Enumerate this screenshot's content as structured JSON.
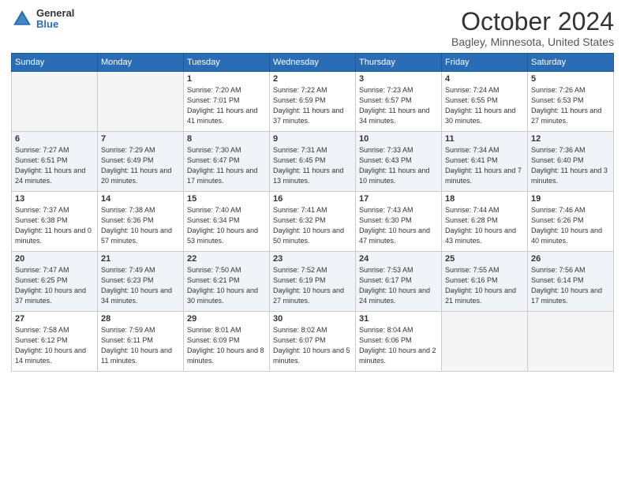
{
  "header": {
    "logo": {
      "general": "General",
      "blue": "Blue"
    },
    "title": "October 2024",
    "subtitle": "Bagley, Minnesota, United States"
  },
  "calendar": {
    "days_of_week": [
      "Sunday",
      "Monday",
      "Tuesday",
      "Wednesday",
      "Thursday",
      "Friday",
      "Saturday"
    ],
    "weeks": [
      [
        {
          "day": "",
          "empty": true
        },
        {
          "day": "",
          "empty": true
        },
        {
          "day": "1",
          "sunrise": "7:20 AM",
          "sunset": "7:01 PM",
          "daylight": "11 hours and 41 minutes."
        },
        {
          "day": "2",
          "sunrise": "7:22 AM",
          "sunset": "6:59 PM",
          "daylight": "11 hours and 37 minutes."
        },
        {
          "day": "3",
          "sunrise": "7:23 AM",
          "sunset": "6:57 PM",
          "daylight": "11 hours and 34 minutes."
        },
        {
          "day": "4",
          "sunrise": "7:24 AM",
          "sunset": "6:55 PM",
          "daylight": "11 hours and 30 minutes."
        },
        {
          "day": "5",
          "sunrise": "7:26 AM",
          "sunset": "6:53 PM",
          "daylight": "11 hours and 27 minutes."
        }
      ],
      [
        {
          "day": "6",
          "sunrise": "7:27 AM",
          "sunset": "6:51 PM",
          "daylight": "11 hours and 24 minutes."
        },
        {
          "day": "7",
          "sunrise": "7:29 AM",
          "sunset": "6:49 PM",
          "daylight": "11 hours and 20 minutes."
        },
        {
          "day": "8",
          "sunrise": "7:30 AM",
          "sunset": "6:47 PM",
          "daylight": "11 hours and 17 minutes."
        },
        {
          "day": "9",
          "sunrise": "7:31 AM",
          "sunset": "6:45 PM",
          "daylight": "11 hours and 13 minutes."
        },
        {
          "day": "10",
          "sunrise": "7:33 AM",
          "sunset": "6:43 PM",
          "daylight": "11 hours and 10 minutes."
        },
        {
          "day": "11",
          "sunrise": "7:34 AM",
          "sunset": "6:41 PM",
          "daylight": "11 hours and 7 minutes."
        },
        {
          "day": "12",
          "sunrise": "7:36 AM",
          "sunset": "6:40 PM",
          "daylight": "11 hours and 3 minutes."
        }
      ],
      [
        {
          "day": "13",
          "sunrise": "7:37 AM",
          "sunset": "6:38 PM",
          "daylight": "11 hours and 0 minutes."
        },
        {
          "day": "14",
          "sunrise": "7:38 AM",
          "sunset": "6:36 PM",
          "daylight": "10 hours and 57 minutes."
        },
        {
          "day": "15",
          "sunrise": "7:40 AM",
          "sunset": "6:34 PM",
          "daylight": "10 hours and 53 minutes."
        },
        {
          "day": "16",
          "sunrise": "7:41 AM",
          "sunset": "6:32 PM",
          "daylight": "10 hours and 50 minutes."
        },
        {
          "day": "17",
          "sunrise": "7:43 AM",
          "sunset": "6:30 PM",
          "daylight": "10 hours and 47 minutes."
        },
        {
          "day": "18",
          "sunrise": "7:44 AM",
          "sunset": "6:28 PM",
          "daylight": "10 hours and 43 minutes."
        },
        {
          "day": "19",
          "sunrise": "7:46 AM",
          "sunset": "6:26 PM",
          "daylight": "10 hours and 40 minutes."
        }
      ],
      [
        {
          "day": "20",
          "sunrise": "7:47 AM",
          "sunset": "6:25 PM",
          "daylight": "10 hours and 37 minutes."
        },
        {
          "day": "21",
          "sunrise": "7:49 AM",
          "sunset": "6:23 PM",
          "daylight": "10 hours and 34 minutes."
        },
        {
          "day": "22",
          "sunrise": "7:50 AM",
          "sunset": "6:21 PM",
          "daylight": "10 hours and 30 minutes."
        },
        {
          "day": "23",
          "sunrise": "7:52 AM",
          "sunset": "6:19 PM",
          "daylight": "10 hours and 27 minutes."
        },
        {
          "day": "24",
          "sunrise": "7:53 AM",
          "sunset": "6:17 PM",
          "daylight": "10 hours and 24 minutes."
        },
        {
          "day": "25",
          "sunrise": "7:55 AM",
          "sunset": "6:16 PM",
          "daylight": "10 hours and 21 minutes."
        },
        {
          "day": "26",
          "sunrise": "7:56 AM",
          "sunset": "6:14 PM",
          "daylight": "10 hours and 17 minutes."
        }
      ],
      [
        {
          "day": "27",
          "sunrise": "7:58 AM",
          "sunset": "6:12 PM",
          "daylight": "10 hours and 14 minutes."
        },
        {
          "day": "28",
          "sunrise": "7:59 AM",
          "sunset": "6:11 PM",
          "daylight": "10 hours and 11 minutes."
        },
        {
          "day": "29",
          "sunrise": "8:01 AM",
          "sunset": "6:09 PM",
          "daylight": "10 hours and 8 minutes."
        },
        {
          "day": "30",
          "sunrise": "8:02 AM",
          "sunset": "6:07 PM",
          "daylight": "10 hours and 5 minutes."
        },
        {
          "day": "31",
          "sunrise": "8:04 AM",
          "sunset": "6:06 PM",
          "daylight": "10 hours and 2 minutes."
        },
        {
          "day": "",
          "empty": true
        },
        {
          "day": "",
          "empty": true
        }
      ]
    ]
  }
}
